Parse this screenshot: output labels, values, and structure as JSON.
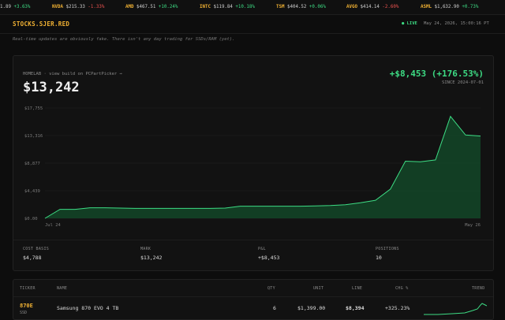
{
  "ticker": [
    {
      "sym": "",
      "price": "1.89",
      "chg": "+3.63%",
      "dir": "up"
    },
    {
      "sym": "NVDA",
      "price": "$215.33",
      "chg": "-1.33%",
      "dir": "dn"
    },
    {
      "sym": "AMD",
      "price": "$467.51",
      "chg": "+10.24%",
      "dir": "up"
    },
    {
      "sym": "INTC",
      "price": "$119.84",
      "chg": "+10.18%",
      "dir": "up"
    },
    {
      "sym": "TSM",
      "price": "$404.52",
      "chg": "+0.06%",
      "dir": "up"
    },
    {
      "sym": "AVGO",
      "price": "$414.14",
      "chg": "-2.60%",
      "dir": "dn"
    },
    {
      "sym": "ASML",
      "price": "$1,632.90",
      "chg": "+0.73%",
      "dir": "up"
    }
  ],
  "header": {
    "brand": "STOCKS.SJER.RED",
    "live": "● LIVE",
    "clock": "May 24, 2026, 15:00:16 PT"
  },
  "note": "Real-time updates are obviously fake. There isn't any day trading for SSDs/RAM (yet).",
  "portfolio": {
    "build_link": "HOMELAB · view build on PCPartPicker →",
    "value": "$13,242",
    "pnl": "+$8,453 (+176.53%)",
    "since": "SINCE 2024-07-01"
  },
  "chart_data": {
    "type": "area",
    "y_ticks": [
      "$0.00",
      "$4,439",
      "$8,877",
      "$13,316",
      "$17,755"
    ],
    "ylim": [
      0,
      17755
    ],
    "x_tick_labels": [
      "Jul 24",
      "May 26"
    ],
    "x": [
      0,
      1,
      2,
      3,
      4,
      5,
      6,
      7,
      8,
      9,
      10,
      11,
      12,
      13,
      14,
      15,
      16,
      17,
      18,
      19,
      20,
      21,
      22,
      23,
      24,
      25,
      26,
      27,
      28,
      29
    ],
    "series": [
      {
        "values": [
          0,
          1450,
          1450,
          1700,
          1700,
          1650,
          1600,
          1600,
          1600,
          1600,
          1600,
          1600,
          1650,
          1950,
          1950,
          1950,
          1950,
          1950,
          2000,
          2050,
          2200,
          2500,
          2900,
          4700,
          9200,
          9100,
          9400,
          16400,
          13400,
          13242
        ],
        "color": "#3ddc84"
      }
    ],
    "grid": true,
    "accent": "#3ddc84"
  },
  "stats": [
    {
      "label": "COST BASIS",
      "value": "$4,788",
      "color": "#dddddd"
    },
    {
      "label": "MARK",
      "value": "$13,242",
      "color": "#dddddd"
    },
    {
      "label": "P&L",
      "value": "+$8,453",
      "color": "#3ddc84"
    },
    {
      "label": "POSITIONS",
      "value": "10",
      "color": "#dddddd"
    }
  ],
  "holdings": {
    "columns": [
      "TICKER",
      "NAME",
      "QTY",
      "UNIT",
      "LINE",
      "CHG %",
      "TREND"
    ],
    "rows": [
      {
        "ticker": "870E",
        "type": "SSD",
        "name": "Samsung 870 EVO 4 TB",
        "qty": "6",
        "unit": "$1,399.00",
        "line": "$8,394",
        "chg": "+325.23%"
      }
    ]
  }
}
